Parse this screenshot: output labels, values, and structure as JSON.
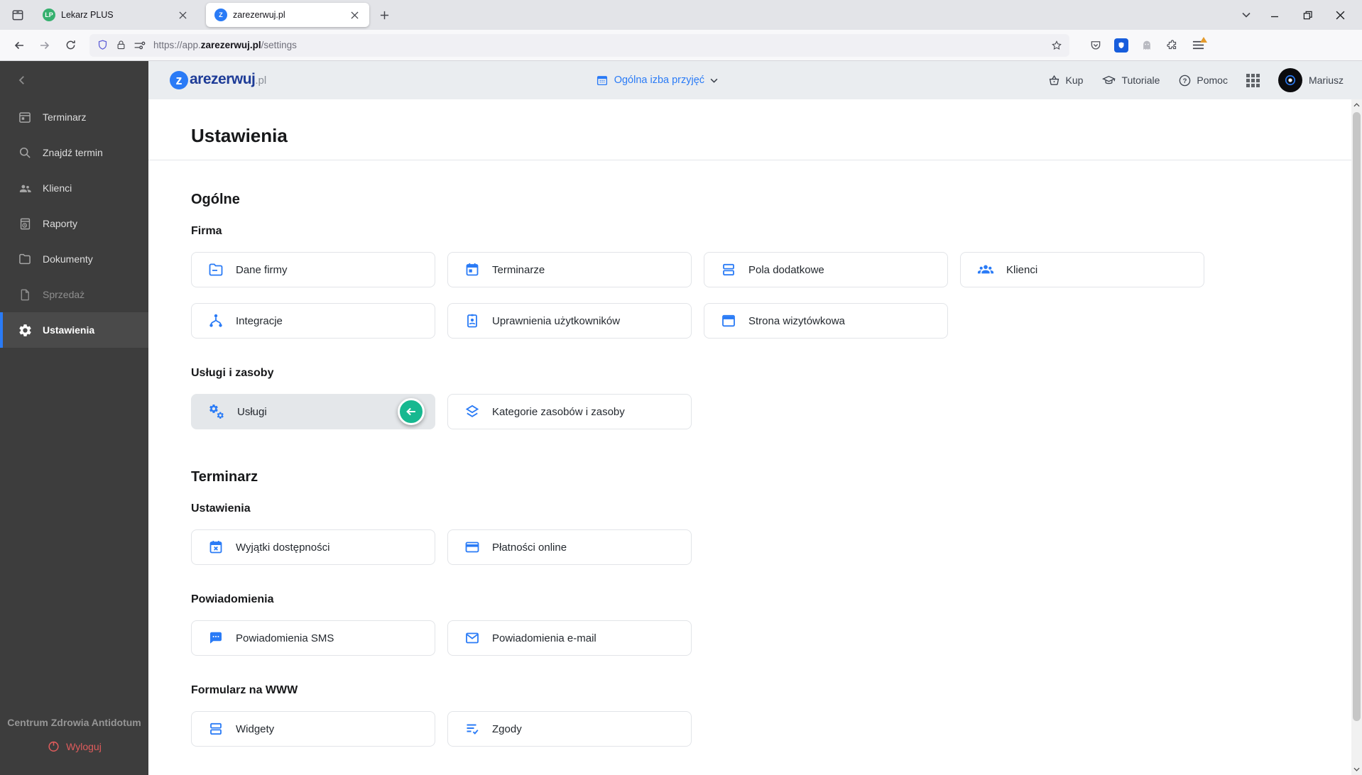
{
  "browser": {
    "tab1": {
      "title": "Lekarz PLUS",
      "favicon": "LP"
    },
    "tab2": {
      "title": "zarezerwuj.pl",
      "favicon": "Z"
    },
    "url_prefix": "https://app.",
    "url_domain": "zarezerwuj.pl",
    "url_path": "/settings"
  },
  "header": {
    "logo_initial": "z",
    "logo_name": "arezerwuj",
    "logo_tld": ".pl",
    "location_selector": "Ogólna izba przyjęć",
    "buy_label": "Kup",
    "tutorials_label": "Tutoriale",
    "help_label": "Pomoc",
    "user_name": "Mariusz"
  },
  "icons": {
    "help_glyph": "?"
  },
  "sidebar": {
    "items": [
      {
        "label": "Terminarz"
      },
      {
        "label": "Znajdź termin"
      },
      {
        "label": "Klienci"
      },
      {
        "label": "Raporty"
      },
      {
        "label": "Dokumenty"
      },
      {
        "label": "Sprzedaż"
      },
      {
        "label": "Ustawienia"
      }
    ],
    "company": "Centrum Zdrowia Antidotum",
    "logout_label": "Wyloguj"
  },
  "page": {
    "title": "Ustawienia",
    "sections": [
      {
        "title": "Ogólne"
      },
      {
        "title": "Terminarz"
      }
    ],
    "groups": [
      {
        "title": "Firma",
        "buttons": [
          {
            "label": "Dane firmy"
          },
          {
            "label": "Terminarze"
          },
          {
            "label": "Pola dodatkowe"
          },
          {
            "label": "Klienci"
          },
          {
            "label": "Integracje"
          },
          {
            "label": "Uprawnienia użytkowników"
          },
          {
            "label": "Strona wizytówkowa"
          }
        ]
      },
      {
        "title": "Usługi i zasoby",
        "buttons": [
          {
            "label": "Usługi",
            "highlighted": true
          },
          {
            "label": "Kategorie zasobów i zasoby"
          }
        ]
      },
      {
        "title": "Ustawienia",
        "buttons": [
          {
            "label": "Wyjątki dostępności"
          },
          {
            "label": "Płatności online"
          }
        ]
      },
      {
        "title": "Powiadomienia",
        "buttons": [
          {
            "label": "Powiadomienia SMS"
          },
          {
            "label": "Powiadomienia e-mail"
          }
        ]
      },
      {
        "title": "Formularz na WWW",
        "buttons": [
          {
            "label": "Widgety"
          },
          {
            "label": "Zgody"
          }
        ]
      }
    ]
  },
  "colors": {
    "accent_blue": "#2a7bf6",
    "brand_navy": "#1e3c97",
    "badge_green": "#17b890",
    "logout_red": "#e05c5c",
    "bitwarden_blue": "#175ddc",
    "menu_alert_orange": "#e49b2d"
  }
}
